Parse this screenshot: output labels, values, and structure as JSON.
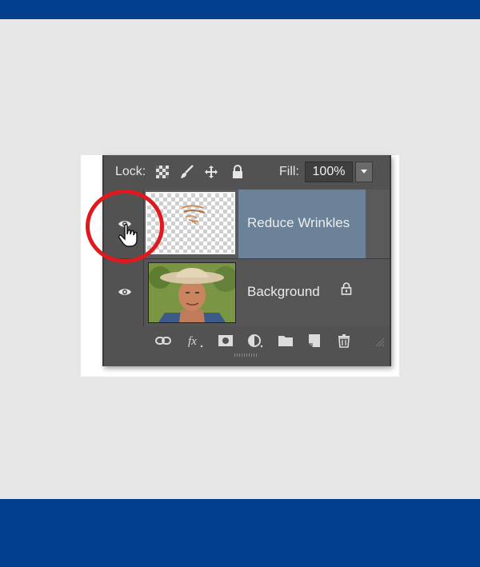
{
  "panel": {
    "lock_label": "Lock:",
    "fill_label": "Fill:",
    "fill_value": "100%"
  },
  "layers": [
    {
      "name": "Reduce Wrinkles",
      "selected": true,
      "visible": true,
      "locked": false
    },
    {
      "name": "Background",
      "selected": false,
      "visible": true,
      "locked": true
    }
  ],
  "colors": {
    "banner": "#023f8f",
    "panel_bg": "#525252",
    "selected_row": "#6b8298",
    "highlight_circle": "#e0191f"
  },
  "icons": {
    "lock_row": [
      "lock-transparent-pixels-icon",
      "lock-image-pixels-icon",
      "lock-position-icon",
      "lock-all-icon"
    ],
    "footer": [
      "link-layers-icon",
      "layer-style-fx-icon",
      "add-mask-icon",
      "adjustment-layer-icon",
      "group-folder-icon",
      "new-layer-icon",
      "trash-icon"
    ]
  }
}
